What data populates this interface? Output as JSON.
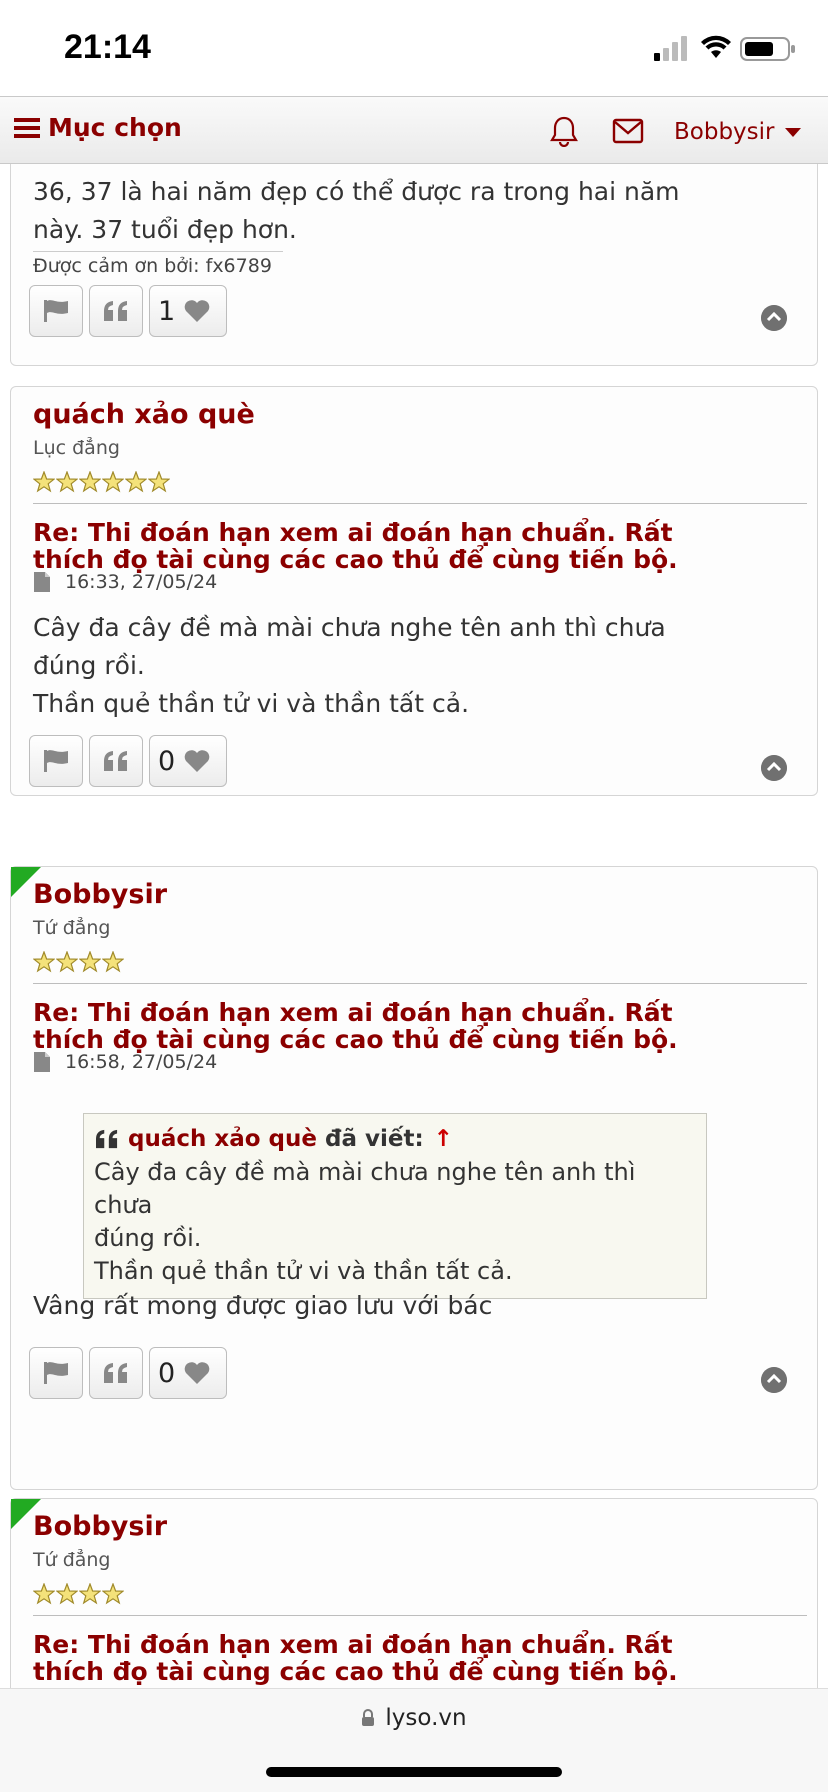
{
  "status_bar": {
    "time": "21:14"
  },
  "navbar": {
    "menu_label": "Mục chọn",
    "username": "Bobbysir"
  },
  "post0": {
    "text_lines": [
      "36, 37 là hai năm đẹp có thể được ra trong hai năm",
      "này. 37 tuổi đẹp hơn."
    ],
    "thanks": "Được cảm ơn bởi: fx6789",
    "like_count": "1"
  },
  "post1": {
    "author": "quách xảo què",
    "rank": "Lục đẳng",
    "stars": 6,
    "title_lines": [
      "Re: Thi đoán hạn xem ai đoán hạn chuẩn. Rất",
      "thích đọ tài cùng các cao thủ để cùng tiến bộ."
    ],
    "time": "16:33, 27/05/24",
    "text_lines": [
      "Cây đa cây đề mà mài chưa nghe tên anh thì chưa",
      "đúng rồi.",
      "Thần quẻ thần tử vi và thần tất cả."
    ],
    "like_count": "0"
  },
  "post2": {
    "author": "Bobbysir",
    "rank": "Tứ đẳng",
    "stars": 4,
    "title_lines": [
      "Re: Thi đoán hạn xem ai đoán hạn chuẩn. Rất",
      "thích đọ tài cùng các cao thủ để cùng tiến bộ."
    ],
    "time": "16:58, 27/05/24",
    "quote": {
      "author": "quách xảo què",
      "wrote": "đã viết:",
      "arrow": "↑",
      "lines": [
        "Cây đa cây đề mà mài chưa nghe tên anh thì chưa",
        "đúng rồi.",
        "Thần quẻ thần tử vi và thần tất cả."
      ]
    },
    "text": "Vâng rất mong được giao lưu với bác",
    "like_count": "0"
  },
  "post3": {
    "author": "Bobbysir",
    "rank": "Tứ đẳng",
    "stars": 4,
    "title_lines": [
      "Re: Thi đoán hạn xem ai đoán hạn chuẩn. Rất",
      "thích đọ tài cùng các cao thủ để cùng tiến bộ."
    ]
  },
  "browser": {
    "url": "lyso.vn"
  },
  "colors": {
    "accent": "#8b0000",
    "new_post_marker": "#22aa22"
  },
  "icons": [
    "menu-icon",
    "bell-icon",
    "mail-icon",
    "flag-icon",
    "quote-icon",
    "heart-icon",
    "arrow-up-icon",
    "star-icon",
    "document-icon",
    "lock-icon"
  ]
}
